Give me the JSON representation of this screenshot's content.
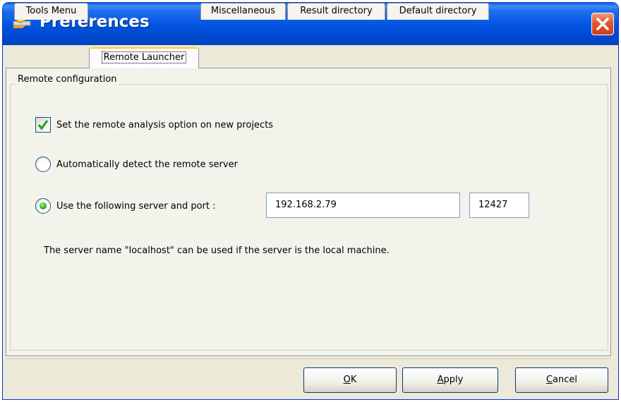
{
  "window": {
    "title": "Preferences",
    "colors": {
      "titlebar": "#0052e0",
      "close": "#e3572a",
      "active_tab_accent": "#ffc83c",
      "radio_selected": "#21a121",
      "check_mark": "#21a121"
    }
  },
  "tabs": [
    {
      "label": "Tools Menu",
      "active": false
    },
    {
      "label": "Remote Launcher",
      "active": true
    },
    {
      "label": "Miscellaneous",
      "active": false
    },
    {
      "label": "Result directory",
      "active": false
    },
    {
      "label": "Default directory",
      "active": false
    }
  ],
  "remote": {
    "group_title": "Remote configuration",
    "checkbox_label": "Set the remote analysis option on new projects",
    "checkbox_checked": true,
    "radio_auto_label": "Automatically detect the remote server",
    "radio_auto_selected": false,
    "radio_manual_label": "Use the following server and port :",
    "radio_manual_selected": true,
    "server_value": "192.168.2.79",
    "port_value": "12427",
    "hint": "The server name \"localhost\" can be used if the server is the local machine."
  },
  "buttons": {
    "ok": {
      "mnemonic": "O",
      "rest": "K"
    },
    "apply": {
      "mnemonic": "A",
      "rest": "pply"
    },
    "cancel": {
      "mnemonic": "C",
      "rest": "ancel"
    }
  }
}
